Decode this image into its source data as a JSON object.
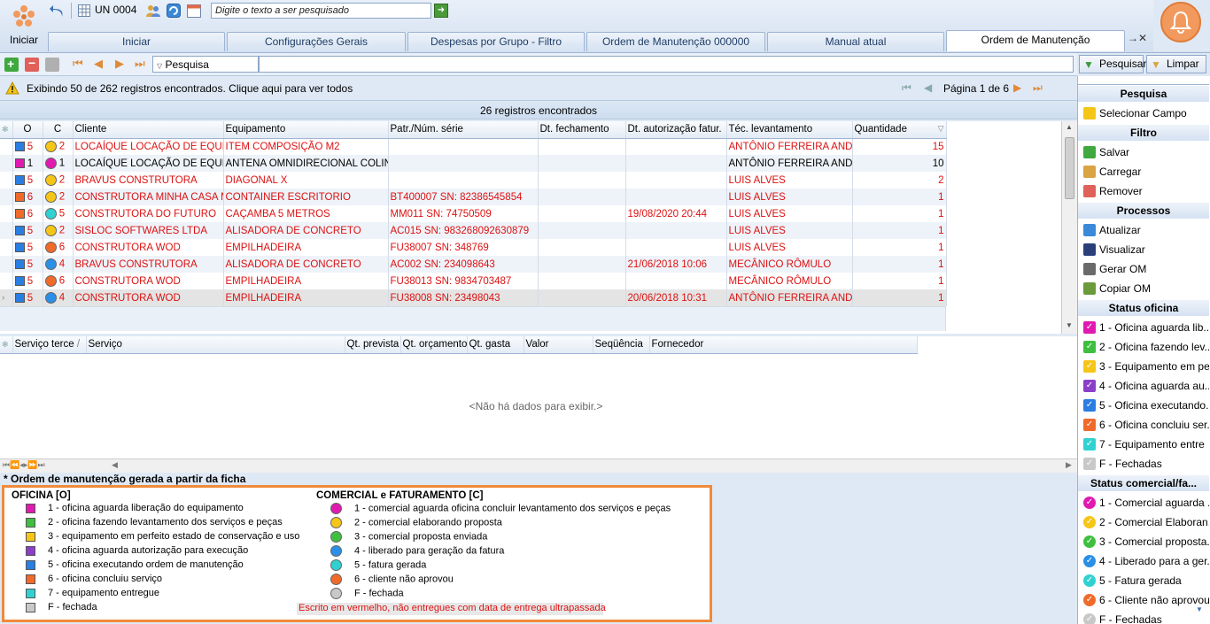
{
  "topbar": {
    "start_label": "Iniciar",
    "un_label": "UN 0004",
    "search_placeholder": "Digite o texto a ser pesquisado"
  },
  "tabs": [
    {
      "label": "Iniciar"
    },
    {
      "label": "Configurações Gerais"
    },
    {
      "label": "Despesas por Grupo - Filtro"
    },
    {
      "label": "Ordem de Manutenção 000000"
    },
    {
      "label": "Manual atual"
    },
    {
      "label": "Ordem de Manutenção"
    }
  ],
  "toolbar": {
    "search_field_label": "Pesquisa",
    "pesquisar_label": "Pesquisar",
    "limpar_label": "Limpar"
  },
  "info": {
    "message": "Exibindo 50 de 262 registros encontrados. Clique aqui para ver todos",
    "page_text": "Página 1 de 6",
    "records_found": "26 registros encontrados"
  },
  "grid": {
    "columns": [
      "O",
      "C",
      "Cliente",
      "Equipamento",
      "Patr./Núm. série",
      "Dt. fechamento",
      "Dt. autorização fatur.",
      "Téc. levantamento",
      "Quantidade"
    ],
    "rows": [
      {
        "o": "5",
        "oc": "#2a7de1",
        "c": "2",
        "cc": "#f5c518",
        "cliente": "LOCAÍQUE LOCAÇÃO DE EQUIPAM",
        "equip": "ITEM COMPOSIÇÃO M2",
        "patr": "",
        "dtf": "",
        "dta": "",
        "tec": "ANTÔNIO FERREIRA ANDRA",
        "qtd": "15",
        "red": true
      },
      {
        "o": "1",
        "oc": "#e01ab0",
        "c": "1",
        "cc": "#e01ab0",
        "cliente": "LOCAÍQUE LOCAÇÃO DE EQUIPAM",
        "equip": "ANTENA OMNIDIRECIONAL COLINEAR",
        "patr": "",
        "dtf": "",
        "dta": "",
        "tec": "ANTÔNIO FERREIRA ANDRA",
        "qtd": "10",
        "red": false
      },
      {
        "o": "5",
        "oc": "#2a7de1",
        "c": "2",
        "cc": "#f5c518",
        "cliente": "BRAVUS CONSTRUTORA",
        "equip": "DIAGONAL X",
        "patr": "",
        "dtf": "",
        "dta": "",
        "tec": "LUIS ALVES",
        "qtd": "2",
        "red": true
      },
      {
        "o": "6",
        "oc": "#f06a2a",
        "c": "2",
        "cc": "#f5c518",
        "cliente": "CONSTRUTORA MINHA CASA MIN",
        "equip": "CONTAINER ESCRITORIO",
        "patr": "BT400007 SN: 82386545854",
        "dtf": "",
        "dta": "",
        "tec": "LUIS ALVES",
        "qtd": "1",
        "red": true
      },
      {
        "o": "6",
        "oc": "#f06a2a",
        "c": "5",
        "cc": "#31d1d1",
        "cliente": "CONSTRUTORA DO FUTURO",
        "equip": "CAÇAMBA 5 METROS",
        "patr": "MM011 SN: 74750509",
        "dtf": "",
        "dta": "19/08/2020 20:44",
        "tec": "LUIS ALVES",
        "qtd": "1",
        "red": true
      },
      {
        "o": "5",
        "oc": "#2a7de1",
        "c": "2",
        "cc": "#f5c518",
        "cliente": "SISLOC SOFTWARES LTDA",
        "equip": "ALISADORA DE CONCRETO",
        "patr": "AC015 SN: 983268092630879",
        "dtf": "",
        "dta": "",
        "tec": "LUIS ALVES",
        "qtd": "1",
        "red": true
      },
      {
        "o": "5",
        "oc": "#2a7de1",
        "c": "6",
        "cc": "#f06a2a",
        "cliente": "CONSTRUTORA WOD",
        "equip": "EMPILHADEIRA",
        "patr": "FU38007 SN: 348769",
        "dtf": "",
        "dta": "",
        "tec": "LUIS ALVES",
        "qtd": "1",
        "red": true
      },
      {
        "o": "5",
        "oc": "#2a7de1",
        "c": "4",
        "cc": "#2a8fe6",
        "cliente": "BRAVUS CONSTRUTORA",
        "equip": "ALISADORA DE CONCRETO",
        "patr": "AC002 SN: 234098643",
        "dtf": "",
        "dta": "21/06/2018 10:06",
        "tec": "MECÂNICO RÔMULO",
        "qtd": "1",
        "red": true
      },
      {
        "o": "5",
        "oc": "#2a7de1",
        "c": "6",
        "cc": "#f06a2a",
        "cliente": "CONSTRUTORA WOD",
        "equip": "EMPILHADEIRA",
        "patr": "FU38013 SN: 9834703487",
        "dtf": "",
        "dta": "",
        "tec": "MECÂNICO RÔMULO",
        "qtd": "1",
        "red": true
      },
      {
        "o": "5",
        "oc": "#2a7de1",
        "c": "4",
        "cc": "#2a8fe6",
        "cliente": "CONSTRUTORA WOD",
        "equip": "EMPILHADEIRA",
        "patr": "FU38008 SN: 23498043",
        "dtf": "",
        "dta": "20/06/2018 10:31",
        "tec": "ANTÔNIO FERREIRA ANDRA",
        "qtd": "1",
        "red": true
      }
    ]
  },
  "lower_grid": {
    "columns": [
      "Serviço terce",
      "Serviço",
      "Qt. prevista",
      "Qt. orçamento",
      "Qt. gasta",
      "Valor",
      "Seqüência",
      "Fornecedor"
    ],
    "empty_text": "<Não há dados para exibir.>"
  },
  "legend": {
    "note": "* Ordem de manutenção gerada a partir da ficha",
    "oficina_title": "OFICINA [O]",
    "comercial_title": "COMERCIAL e FATURAMENTO [C]",
    "oficina_items": [
      {
        "label": "1 - oficina aguarda liberação do equipamento",
        "color": "#e01ab0"
      },
      {
        "label": "2 - oficina fazendo levantamento dos serviços e peças",
        "color": "#3fbf3f"
      },
      {
        "label": "3 - equipamento em perfeito estado de conservação e uso",
        "color": "#f5c518"
      },
      {
        "label": "4 - oficina aguarda autorização para execução",
        "color": "#8a3fc8"
      },
      {
        "label": "5 - oficina executando ordem de manutenção",
        "color": "#2a7de1"
      },
      {
        "label": "6 - oficina concluiu serviço",
        "color": "#f06a2a"
      },
      {
        "label": "7 - equipamento entregue",
        "color": "#31d1d1"
      },
      {
        "label": "F - fechada",
        "color": "#c8c8c8"
      }
    ],
    "comercial_items": [
      {
        "label": "1 - comercial aguarda oficina concluir levantamento dos serviços e peças",
        "color": "#e01ab0"
      },
      {
        "label": "2 - comercial elaborando proposta",
        "color": "#f5c518"
      },
      {
        "label": "3 - comercial proposta enviada",
        "color": "#3fbf3f"
      },
      {
        "label": "4 - liberado para geração da fatura",
        "color": "#2a8fe6"
      },
      {
        "label": "5 - fatura gerada",
        "color": "#31d1d1"
      },
      {
        "label": "6 - cliente não aprovou",
        "color": "#f06a2a"
      },
      {
        "label": "F - fechada",
        "color": "#c8c8c8"
      }
    ],
    "red_note": "Escrito em vermelho, não entregues com data de entrega ultrapassada"
  },
  "sidebar": {
    "pesquisa_title": "Pesquisa",
    "selecionar_campo": "Selecionar Campo",
    "filtro_title": "Filtro",
    "salvar": "Salvar",
    "carregar": "Carregar",
    "remover": "Remover",
    "processos_title": "Processos",
    "atualizar": "Atualizar",
    "visualizar": "Visualizar",
    "gerar_om": "Gerar OM",
    "copiar_om": "Copiar OM",
    "status_oficina_title": "Status oficina",
    "status_oficina": [
      {
        "label": "1 - Oficina aguarda lib...",
        "color": "#e01ab0"
      },
      {
        "label": "2 - Oficina fazendo lev...",
        "color": "#3fbf3f"
      },
      {
        "label": "3 - Equipamento em pe...",
        "color": "#f5c518"
      },
      {
        "label": "4 - Oficina aguarda au...",
        "color": "#8a3fc8"
      },
      {
        "label": "5 - Oficina executando...",
        "color": "#2a7de1"
      },
      {
        "label": "6 - Oficina concluiu ser...",
        "color": "#f06a2a"
      },
      {
        "label": "7 - Equipamento entre",
        "color": "#31d1d1"
      },
      {
        "label": "F - Fechadas",
        "color": "#c8c8c8"
      }
    ],
    "status_comercial_title": "Status comercial/fa...",
    "status_comercial": [
      {
        "label": "1 - Comercial aguarda ...",
        "color": "#e01ab0"
      },
      {
        "label": "2 - Comercial Elaboran...",
        "color": "#f5c518"
      },
      {
        "label": "3 - Comercial proposta...",
        "color": "#3fbf3f"
      },
      {
        "label": "4 - Liberado para a ger...",
        "color": "#2a8fe6"
      },
      {
        "label": "5 - Fatura gerada",
        "color": "#31d1d1"
      },
      {
        "label": "6 - Cliente não aprovou",
        "color": "#f06a2a"
      },
      {
        "label": "F - Fechadas",
        "color": "#c8c8c8"
      }
    ]
  }
}
